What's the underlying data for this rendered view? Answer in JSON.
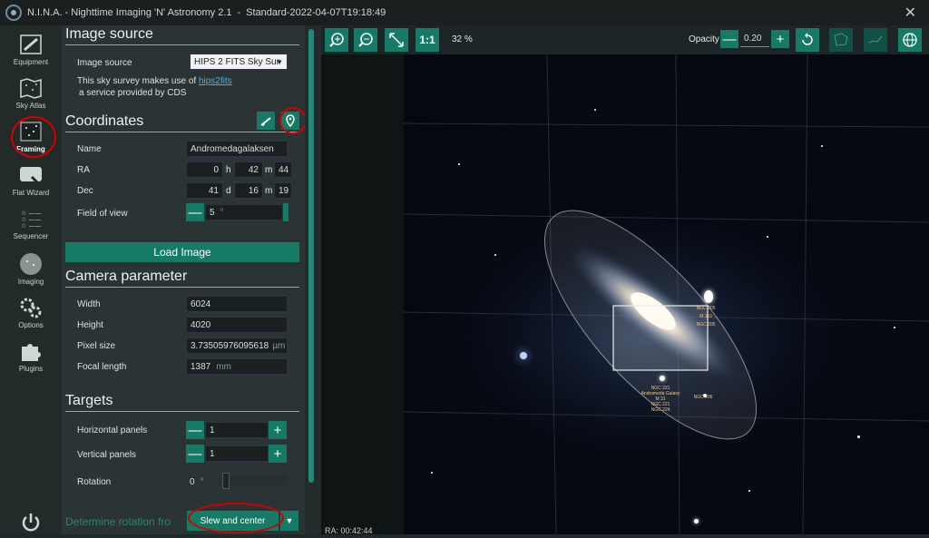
{
  "window": {
    "app_title": "N.I.N.A. - Nighttime Imaging 'N' Astronomy 2.1",
    "profile": "Standard-2022-04-07T19:18:49",
    "close_label": "✕"
  },
  "sidebar": {
    "items": [
      {
        "label": "Equipment",
        "icon": "telescope-icon"
      },
      {
        "label": "Sky Atlas",
        "icon": "map-icon"
      },
      {
        "label": "Framing",
        "icon": "framing-icon",
        "active": true
      },
      {
        "label": "Flat Wizard",
        "icon": "flat-wizard-icon"
      },
      {
        "label": "Sequencer",
        "icon": "sequencer-icon"
      },
      {
        "label": "Imaging",
        "icon": "imaging-icon"
      },
      {
        "label": "Options",
        "icon": "gears-icon"
      },
      {
        "label": "Plugins",
        "icon": "puzzle-icon"
      }
    ],
    "power_icon": "power-icon"
  },
  "image_source": {
    "heading": "Image source",
    "label": "Image source",
    "value": "HIPS 2 FITS Sky Sur",
    "note_prefix": "This sky survey makes use of ",
    "note_link": "hips2fits",
    "note_suffix": "a service provided by CDS"
  },
  "coordinates": {
    "heading": "Coordinates",
    "name_label": "Name",
    "name_value": "Andromedagalaksen",
    "ra_label": "RA",
    "ra_h": "0",
    "ra_h_unit": "h",
    "ra_m": "42",
    "ra_m_unit": "m",
    "ra_s": "44",
    "dec_label": "Dec",
    "dec_d": "41",
    "dec_d_unit": "d",
    "dec_m": "16",
    "dec_m_unit": "m",
    "dec_s": "19",
    "fov_label": "Field of view",
    "fov_value": "5",
    "fov_unit": "°",
    "minus": "—",
    "load_image": "Load Image"
  },
  "camera": {
    "heading": "Camera parameter",
    "width_label": "Width",
    "width_value": "6024",
    "height_label": "Height",
    "height_value": "4020",
    "pixel_label": "Pixel size",
    "pixel_value": "3.73505976095618",
    "pixel_unit": "µm",
    "focal_label": "Focal length",
    "focal_value": "1387",
    "focal_unit": "mm"
  },
  "targets": {
    "heading": "Targets",
    "hpanels_label": "Horizontal panels",
    "hpanels_value": "1",
    "vpanels_label": "Vertical panels",
    "vpanels_value": "1",
    "rotation_label": "Rotation",
    "rotation_value": "0",
    "rotation_unit": "°",
    "determine_label": "Determine rotation fro",
    "slew_button": "Slew and center",
    "minus": "—",
    "plus": "+"
  },
  "toolbar": {
    "one_to_one": "1:1",
    "zoom": "32 %",
    "opacity_label": "Opacity",
    "opacity_value": "0.20",
    "minus": "—",
    "plus": "+"
  },
  "sky": {
    "ra_readout": "RA: 00:42:44",
    "labels": [
      {
        "text": "NGC 205"
      },
      {
        "text": "M 110"
      },
      {
        "text": "NGC 205"
      },
      {
        "text": "NGC 221"
      },
      {
        "text": "Andromeda Galaxy"
      },
      {
        "text": "M 31"
      },
      {
        "text": "NGC 221"
      },
      {
        "text": "NGC 224"
      },
      {
        "text": "NGC 206"
      }
    ]
  },
  "colors": {
    "accent": "#157a66",
    "highlight_circle": "#d40000"
  }
}
